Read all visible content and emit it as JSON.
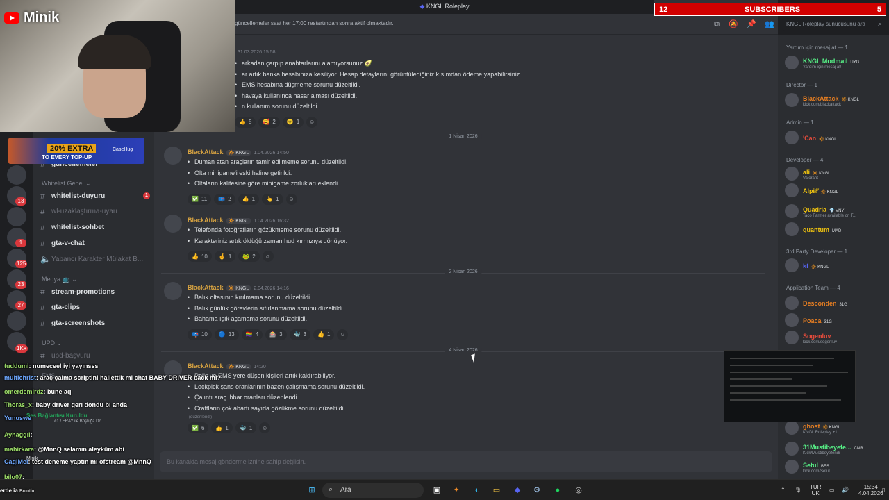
{
  "window": {
    "title": "KNGL Roleplay"
  },
  "overlay": {
    "channel_logo": "Minik",
    "subscribers_count": "12",
    "subscribers_label": "SUBSCRIBERS",
    "subscribers_goal": "5",
    "ad": {
      "headline": "20% EXTRA",
      "subline": "TO EVERY TOP-UP",
      "brand": "CaseHug"
    }
  },
  "header": {
    "topic": "güncellemeler saat her 17:00 restartından sonra aktif olmaktadır.",
    "search_placeholder": "KNGL Roleplay sunucusunu ara"
  },
  "sidebar": {
    "partial_channel": "güncellemeler",
    "categories": [
      {
        "label": "Whitelist Genel ⌄"
      },
      {
        "label": "Medya 📺 ⌄"
      },
      {
        "label": "UPD ⌄"
      },
      {
        "label": "EMS"
      }
    ],
    "channels": [
      {
        "label": "whitelist-duyuru",
        "badge": "1"
      },
      {
        "label": "wl-uzaklaştırma-uyarı"
      },
      {
        "label": "whitelist-sohbet"
      },
      {
        "label": "gta-v-chat"
      },
      {
        "label": "Yabancı Karakter Mülakat B..."
      },
      {
        "label": "stream-promotions"
      },
      {
        "label": "gta-clips"
      },
      {
        "label": "gta-screenshots"
      },
      {
        "label": "upd-başvuru"
      }
    ],
    "rail_badges": [
      "13",
      "1",
      "125",
      "23",
      "27",
      "1K+"
    ]
  },
  "messages": {
    "first": {
      "time": "31.03.2026 15:58",
      "lines": [
        "arkadan çarpıp anahtarlarını alamıyorsunuz 🥑",
        "ar artık banka hesabınıza kesiliyor. Hesap detaylarını görüntülediğiniz kısımdan ödeme yapabilirsiniz.",
        "EMS hesabına düşmeme sorunu düzeltildi.",
        "havaya kullanınca hasar alması düzeltildi.",
        "n kullanım sorunu düzeltildi."
      ],
      "reactions": [
        {
          "e": "👍",
          "n": "5"
        },
        {
          "e": "🥰",
          "n": "2"
        },
        {
          "e": "🙂",
          "n": "1"
        }
      ]
    },
    "dividers": [
      "1 Nisan 2026",
      "2 Nisan 2026",
      "4 Nisan 2026"
    ],
    "posts": [
      {
        "author": "BlackAttack",
        "tag": "🔆 KNGL",
        "time": "1.04.2026 14:50",
        "lines": [
          "Duman atan araçların tamir edilmeme sorunu düzeltildi.",
          "Olta minigame'i eski haline getirildi.",
          "Oltaların kalitesine göre minigame zorlukları eklendi."
        ],
        "reactions": [
          {
            "e": "✅",
            "n": "11"
          },
          {
            "e": "📪",
            "n": "2"
          },
          {
            "e": "👍",
            "n": "1"
          },
          {
            "e": "👆",
            "n": "1"
          }
        ]
      },
      {
        "author": "BlackAttack",
        "tag": "🔆 KNGL",
        "time": "1.04.2026 16:32",
        "lines": [
          "Telefonda fotoğrafların gözükmeme sorunu düzeltildi.",
          "Karakteriniz artık öldüğü zaman hud kırmızıya dönüyor."
        ],
        "reactions": [
          {
            "e": "👍",
            "n": "10"
          },
          {
            "e": "🤞",
            "n": "1"
          },
          {
            "e": "🐸",
            "n": "2"
          }
        ]
      },
      {
        "author": "BlackAttack",
        "tag": "🔆 KNGL",
        "time": "2.04.2026 14:16",
        "lines": [
          "Balık oltasının kırılmama sorunu düzeltildi.",
          "Balık günlük görevlerin sıfırlanmama sorunu düzeltildi.",
          "Bahama ışık açamama sorunu düzeltildi."
        ],
        "reactions": [
          {
            "e": "📪",
            "n": "10"
          },
          {
            "e": "🔵",
            "n": "13"
          },
          {
            "e": "🏳️‍🌈",
            "n": "4"
          },
          {
            "e": "🎰",
            "n": "3"
          },
          {
            "e": "🐳",
            "n": "3"
          },
          {
            "e": "👍",
            "n": "1"
          }
        ]
      },
      {
        "author": "BlackAttack",
        "tag": "🔆 KNGL",
        "time": "14:20",
        "lines": [
          "Polis ve EMS yere düşen kişileri artık kaldırabiliyor.",
          "Lockpick şans oranlarının bazen çalışmama sorunu düzeltildi.",
          "Çalıntı araç ihbar oranları düzenlendi.",
          "Craftların çok abartı sayıda gözükme sorunu düzeltildi."
        ],
        "edited": "(düzenlendi)",
        "reactions": [
          {
            "e": "✅",
            "n": "6"
          },
          {
            "e": "👍",
            "n": "1"
          },
          {
            "e": "🐳",
            "n": "1"
          }
        ]
      }
    ]
  },
  "composer": {
    "placeholder": "Bu kanalda mesaj gönderme iznine sahip değilsin."
  },
  "members": {
    "roles": [
      "Yardım için mesaj at — 1",
      "Director — 1",
      "Admin — 1",
      "Developer — 4",
      "3rd Party Developer — 1",
      "Application Team — 4"
    ],
    "list": [
      {
        "name": "KNGL Modmail",
        "tag": "UYG",
        "status": "Yardım için mesaj at!",
        "color": "#57f287"
      },
      {
        "name": "BlackAttack",
        "tag": "🔆 KNGL",
        "status": "kick.com/blackattack",
        "color": "#e67e22"
      },
      {
        "name": "'Can",
        "tag": "🔆 KNGL",
        "status": "",
        "color": "#e74c3c"
      },
      {
        "name": "ali",
        "tag": "🔆 KNGL",
        "status": "Valorant",
        "color": "#f1c40f"
      },
      {
        "name": "Alpi⁄⁄⁄",
        "tag": "🔆 KNGL",
        "status": "",
        "color": "#f1c40f"
      },
      {
        "name": "Quadria",
        "tag": "💎 VNY",
        "status": "Taco Farmer available on T...",
        "color": "#f1c40f"
      },
      {
        "name": "quantum",
        "tag": "MAD",
        "status": "",
        "color": "#f1c40f"
      },
      {
        "name": "kf",
        "tag": "🔆 KNGL",
        "status": "",
        "color": "#5865f2"
      },
      {
        "name": "Desconden",
        "tag": "31G",
        "status": "",
        "color": "#e67e22"
      },
      {
        "name": "Poaca",
        "tag": "31G",
        "status": "",
        "color": "#e67e22"
      },
      {
        "name": "Sogenluv",
        "tag": "",
        "status": "kick.com/sogenluv",
        "color": "#e74c3c"
      },
      {
        "name": "ghost",
        "tag": "🔆 KNGL",
        "status": "KNGL Roleplay +1",
        "color": "#e67e22"
      },
      {
        "name": "31Mustibeyefe...",
        "tag": "CNR",
        "status": "Kick/Mustibeyefendi",
        "color": "#57f287"
      },
      {
        "name": "Setul",
        "tag": "BES",
        "status": "kick.com/Setul",
        "color": "#57f287"
      }
    ]
  },
  "stream_chat": [
    {
      "user": "tuddumi",
      "text": ": numeceel iyi yayınsss"
    },
    {
      "user": "multichrist",
      "text": ": araç çalma scriptini hallettik mi chat BABY DRIVER back mi?"
    },
    {
      "user": "omerdemirdz",
      "text": ": bune aq"
    },
    {
      "user": "Thoras_x",
      "text": ": baby drıver gerı dondu bı anda"
    },
    {
      "user": "Yunuswe",
      "text": ""
    },
    {
      "user": "Ayhaggıl",
      "text": ":"
    },
    {
      "user": "mahirkara",
      "text": ": @MnnQ selamın aleyküm abi"
    },
    {
      "user": "CagiMei",
      "text": ": test deneme yaptın mı ofstream @MnnQ"
    },
    {
      "user": "bilo07",
      "text": ":"
    }
  ],
  "voice": {
    "status": "Ses Bağlantısı Kuruldu",
    "channel": "#1 / ERAY ile Boşluğa Do...",
    "user": "Minik"
  },
  "taskbar": {
    "search": "Ara",
    "lang": "TUR",
    "lang2": "UK",
    "time": "15:34",
    "date": "4.04.2026",
    "bottom_text": "erde ia",
    "weather": "Bulutlu"
  }
}
